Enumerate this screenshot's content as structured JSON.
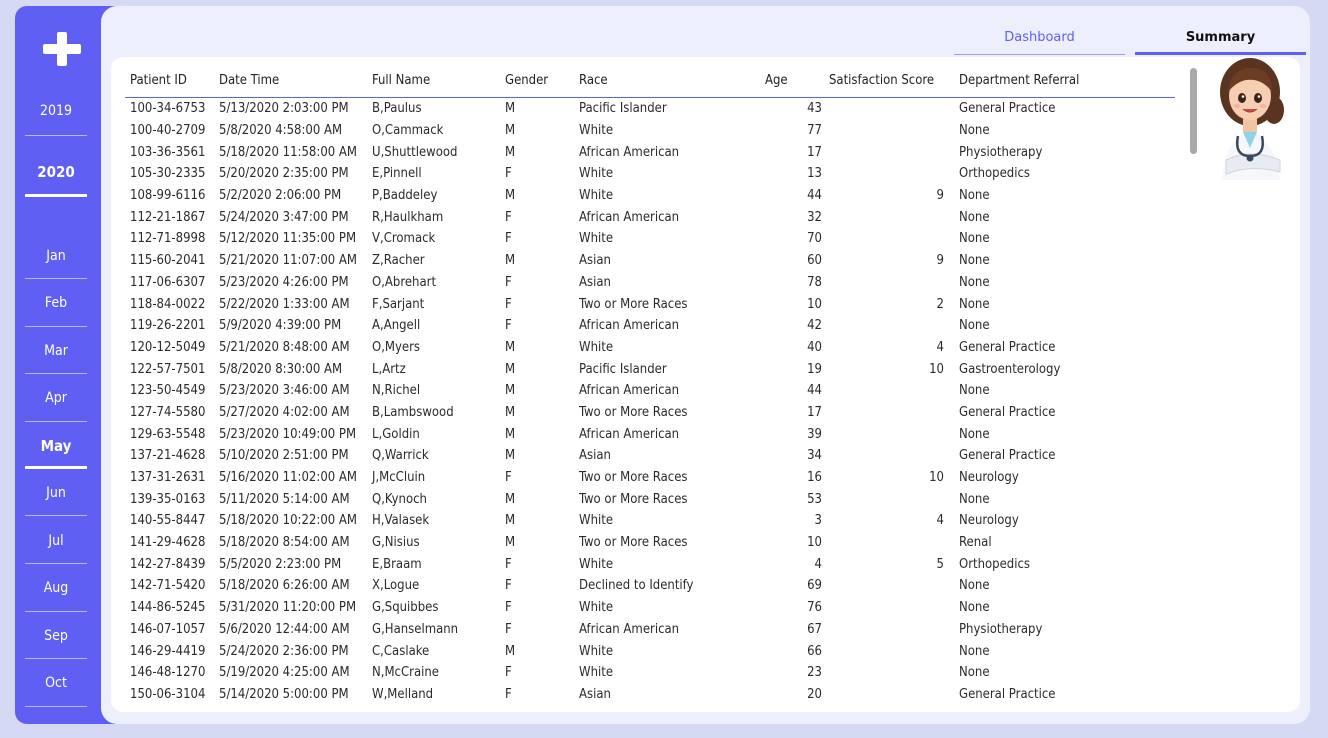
{
  "sidebar": {
    "logo_icon": "plus-icon",
    "years": [
      "2019",
      "2020"
    ],
    "selected_year": "2020",
    "months": [
      "Jan",
      "Feb",
      "Mar",
      "Apr",
      "May",
      "Jun",
      "Jul",
      "Aug",
      "Sep",
      "Oct"
    ],
    "selected_month": "May"
  },
  "tabs": {
    "dashboard": "Dashboard",
    "summary": "Summary",
    "active": "Summary"
  },
  "table": {
    "columns": [
      "Patient ID",
      "Date Time",
      "Full Name",
      "Gender",
      "Race",
      "Age",
      "Satisfaction Score",
      "Department Referral"
    ],
    "rows": [
      [
        "100-34-6753",
        "5/13/2020 2:03:00 PM",
        "B,Paulus",
        "M",
        "Pacific Islander",
        "43",
        "",
        "General Practice"
      ],
      [
        "100-40-2709",
        "5/8/2020 4:58:00 AM",
        "O,Cammack",
        "M",
        "White",
        "77",
        "",
        "None"
      ],
      [
        "103-36-3561",
        "5/18/2020 11:58:00 AM",
        "U,Shuttlewood",
        "M",
        "African American",
        "17",
        "",
        "Physiotherapy"
      ],
      [
        "105-30-2335",
        "5/20/2020 2:35:00 PM",
        "E,Pinnell",
        "F",
        "White",
        "13",
        "",
        "Orthopedics"
      ],
      [
        "108-99-6116",
        "5/2/2020 2:06:00 PM",
        "P,Baddeley",
        "M",
        "White",
        "44",
        "9",
        "None"
      ],
      [
        "112-21-1867",
        "5/24/2020 3:47:00 PM",
        "R,Haulkham",
        "F",
        "African American",
        "32",
        "",
        "None"
      ],
      [
        "112-71-8998",
        "5/12/2020 11:35:00 PM",
        "V,Cromack",
        "F",
        "White",
        "70",
        "",
        "None"
      ],
      [
        "115-60-2041",
        "5/21/2020 11:07:00 AM",
        "Z,Racher",
        "M",
        "Asian",
        "60",
        "9",
        "None"
      ],
      [
        "117-06-6307",
        "5/23/2020 4:26:00 PM",
        "O,Abrehart",
        "F",
        "Asian",
        "78",
        "",
        "None"
      ],
      [
        "118-84-0022",
        "5/22/2020 1:33:00 AM",
        "F,Sarjant",
        "F",
        "Two or More Races",
        "10",
        "2",
        "None"
      ],
      [
        "119-26-2201",
        "5/9/2020 4:39:00 PM",
        "A,Angell",
        "F",
        "African American",
        "42",
        "",
        "None"
      ],
      [
        "120-12-5049",
        "5/21/2020 8:48:00 AM",
        "O,Myers",
        "M",
        "White",
        "40",
        "4",
        "General Practice"
      ],
      [
        "122-57-7501",
        "5/8/2020 8:30:00 AM",
        "L,Artz",
        "M",
        "Pacific Islander",
        "19",
        "10",
        "Gastroenterology"
      ],
      [
        "123-50-4549",
        "5/23/2020 3:46:00 AM",
        "N,Richel",
        "M",
        "African American",
        "44",
        "",
        "None"
      ],
      [
        "127-74-5580",
        "5/27/2020 4:02:00 AM",
        "B,Lambswood",
        "M",
        "Two or More Races",
        "17",
        "",
        "General Practice"
      ],
      [
        "129-63-5548",
        "5/23/2020 10:49:00 PM",
        "L,Goldin",
        "M",
        "African American",
        "39",
        "",
        "None"
      ],
      [
        "137-21-4628",
        "5/10/2020 2:51:00 PM",
        "Q,Warrick",
        "M",
        "Asian",
        "34",
        "",
        "General Practice"
      ],
      [
        "137-31-2631",
        "5/16/2020 11:02:00 AM",
        "J,McCluin",
        "F",
        "Two or More Races",
        "16",
        "10",
        "Neurology"
      ],
      [
        "139-35-0163",
        "5/11/2020 5:14:00 AM",
        "Q,Kynoch",
        "M",
        "Two or More Races",
        "53",
        "",
        "None"
      ],
      [
        "140-55-8447",
        "5/18/2020 10:22:00 AM",
        "H,Valasek",
        "M",
        "White",
        "3",
        "4",
        "Neurology"
      ],
      [
        "141-29-4628",
        "5/18/2020 8:54:00 AM",
        "G,Nisius",
        "M",
        "Two or More Races",
        "10",
        "",
        "Renal"
      ],
      [
        "142-27-8439",
        "5/5/2020 2:23:00 PM",
        "E,Braam",
        "F",
        "White",
        "4",
        "5",
        "Orthopedics"
      ],
      [
        "142-71-5420",
        "5/18/2020 6:26:00 AM",
        "X,Logue",
        "F",
        "Declined to Identify",
        "69",
        "",
        "None"
      ],
      [
        "144-86-5245",
        "5/31/2020 11:20:00 PM",
        "G,Squibbes",
        "F",
        "White",
        "76",
        "",
        "None"
      ],
      [
        "146-07-1057",
        "5/6/2020 12:44:00 AM",
        "G,Hanselmann",
        "F",
        "African American",
        "67",
        "",
        "Physiotherapy"
      ],
      [
        "146-29-4419",
        "5/24/2020 2:36:00 PM",
        "C,Caslake",
        "M",
        "White",
        "66",
        "",
        "None"
      ],
      [
        "146-48-1270",
        "5/19/2020 4:25:00 AM",
        "N,McCraine",
        "F",
        "White",
        "23",
        "",
        "None"
      ],
      [
        "150-06-3104",
        "5/14/2020 5:00:00 PM",
        "W,Melland",
        "F",
        "Asian",
        "20",
        "",
        "General Practice"
      ]
    ]
  },
  "avatar_icon": "nurse-avatar-icon",
  "colors": {
    "accent": "#5f5ff4",
    "background": "#d6d9f3",
    "panel": "#eeeffc"
  }
}
